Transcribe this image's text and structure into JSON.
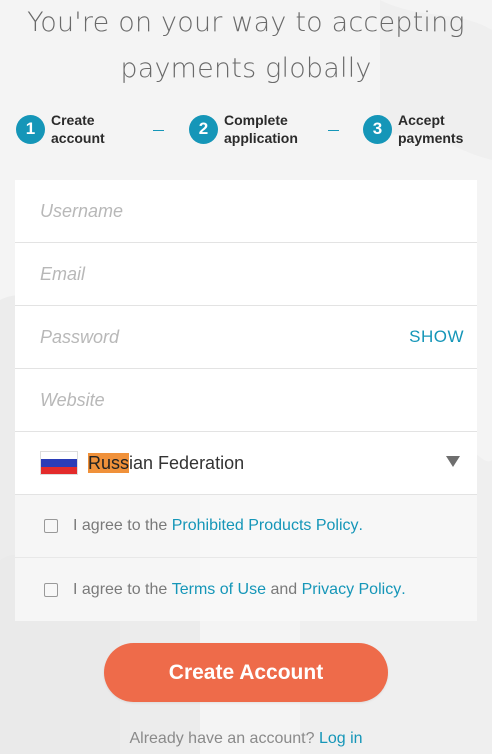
{
  "headline": {
    "line1": "You're on your way to accepting",
    "line2": "payments globally"
  },
  "steps": [
    {
      "number": "1",
      "line1": "Create",
      "line2": "account"
    },
    {
      "number": "2",
      "line1": "Complete",
      "line2": "application"
    },
    {
      "number": "3",
      "line1": "Accept",
      "line2": "payments"
    }
  ],
  "form": {
    "username_placeholder": "Username",
    "email_placeholder": "Email",
    "password_placeholder": "Password",
    "password_show_label": "SHOW",
    "website_placeholder": "Website",
    "country": {
      "highlighted_part": "Russ",
      "rest": "ian Federation",
      "flag_colors": [
        "#ffffff",
        "#2b3db8",
        "#e32b2b"
      ]
    },
    "agreement_1": {
      "prefix": "I agree to the",
      "link": "Prohibited Products Policy",
      "suffix": "."
    },
    "agreement_2": {
      "prefix": "I agree to the",
      "link1": "Terms of Use",
      "middle": "and",
      "link2": "Privacy Policy",
      "suffix": "."
    }
  },
  "create_button_label": "Create Account",
  "login": {
    "prompt": "Already have an account?",
    "link": "Log in"
  },
  "colors": {
    "accent": "#1596b8",
    "button": "#ee6b4a",
    "highlight": "#f0913a"
  }
}
